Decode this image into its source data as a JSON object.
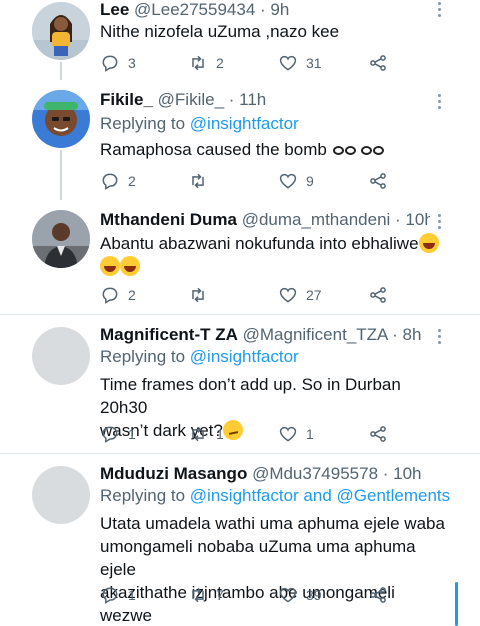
{
  "tweets": [
    {
      "name": "Lee",
      "handle": "@Lee27559434 · 9h",
      "text": "Nithe nizofela uZuma ,nazo kee",
      "replies": "3",
      "retweets": "2",
      "likes": "31"
    },
    {
      "name": "Fikile_",
      "handle": "@Fikile_ · 11h",
      "replying_prefix": "Replying to",
      "replying_to": "@insightfactor",
      "text": "Ramaphosa caused the bomb",
      "replies": "2",
      "retweets": "",
      "likes": "9"
    },
    {
      "name": "Mthandeni Duma",
      "handle": "@duma_mthandeni · 10h",
      "text": "Abantu abazwani nokufunda into ebhaliwe",
      "replies": "2",
      "retweets": "",
      "likes": "27"
    },
    {
      "name": "Magnificent-T ZA",
      "handle": "@Magnificent_TZA · 8h",
      "replying_prefix": "Replying to",
      "replying_to": "@insightfactor",
      "text_line1": "Time frames don’t add up. So in Durban 20h30",
      "text_line2": "wasn’t dark yet?",
      "replies": "1",
      "retweets": "1",
      "likes": "1"
    },
    {
      "name": "Mduduzi Masango",
      "handle": "@Mdu37495578 · 10h",
      "replying_prefix": "Replying to",
      "replying_to": "@insightfactor and @Gentlements",
      "text_line1": "Utata umadela wathi uma aphuma ejele waba",
      "text_line2": "umongameli nobaba uZuma uma aphuma ejele",
      "text_line3": "akazithathe izjntambo abe umongameli wezwe",
      "replies": "1",
      "retweets": "7",
      "likes": "39"
    }
  ],
  "icons": {
    "reply": "reply-icon",
    "retweet": "retweet-icon",
    "like": "heart-icon",
    "share": "share-icon",
    "more": "more-icon"
  },
  "colors": {
    "link": "#1d9bf0",
    "secondary_text": "#536471",
    "divider": "#e1e8ed"
  }
}
